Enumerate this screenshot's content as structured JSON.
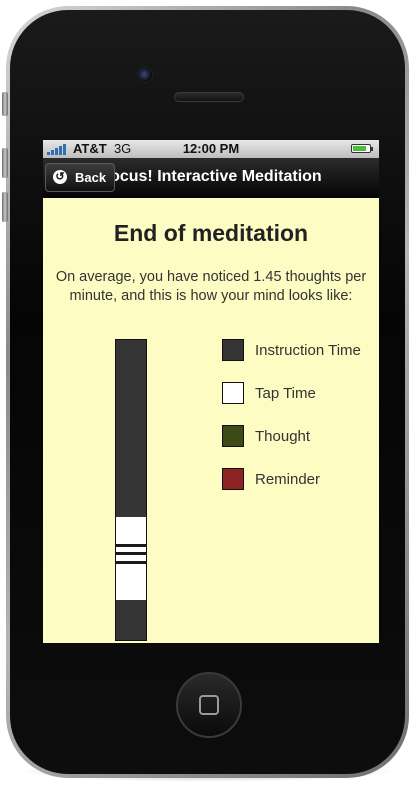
{
  "status_bar": {
    "carrier": "AT&T",
    "network": "3G",
    "time": "12:00 PM"
  },
  "nav_bar": {
    "title": "Focus! Interactive Meditation",
    "back_label": "Back",
    "back_icon": "back-arrow-icon"
  },
  "content": {
    "title": "End of meditation",
    "summary_line1": "On average, you have noticed 1.45 thoughts per",
    "summary_line2": "minute, and this is how your mind looks like:"
  },
  "legend": [
    {
      "label": "Instruction Time",
      "color": "#353535"
    },
    {
      "label": "Tap Time",
      "color": "#ffffff"
    },
    {
      "label": "Thought",
      "color": "#3c4a17"
    },
    {
      "label": "Reminder",
      "color": "#8c2222"
    }
  ],
  "timeline": {
    "segments": [
      {
        "type": "Instruction Time",
        "color": "#353535",
        "start": 0.0,
        "end": 0.59
      },
      {
        "type": "Tap Time",
        "color": "#ffffff",
        "start": 0.59,
        "end": 0.68
      },
      {
        "type": "Thought",
        "color": "#1a1a1a",
        "start": 0.68,
        "end": 0.69
      },
      {
        "type": "Tap Time",
        "color": "#ffffff",
        "start": 0.69,
        "end": 0.705
      },
      {
        "type": "Thought",
        "color": "#1a1a1a",
        "start": 0.705,
        "end": 0.715
      },
      {
        "type": "Tap Time",
        "color": "#ffffff",
        "start": 0.715,
        "end": 0.735
      },
      {
        "type": "Thought",
        "color": "#1a1a1a",
        "start": 0.735,
        "end": 0.745
      },
      {
        "type": "Tap Time",
        "color": "#ffffff",
        "start": 0.745,
        "end": 0.865
      },
      {
        "type": "Instruction Time",
        "color": "#353535",
        "start": 0.865,
        "end": 1.0
      }
    ]
  },
  "colors": {
    "screen_bg": "#fdfcc2",
    "nav_bg": "#111111",
    "text": "#333333"
  }
}
